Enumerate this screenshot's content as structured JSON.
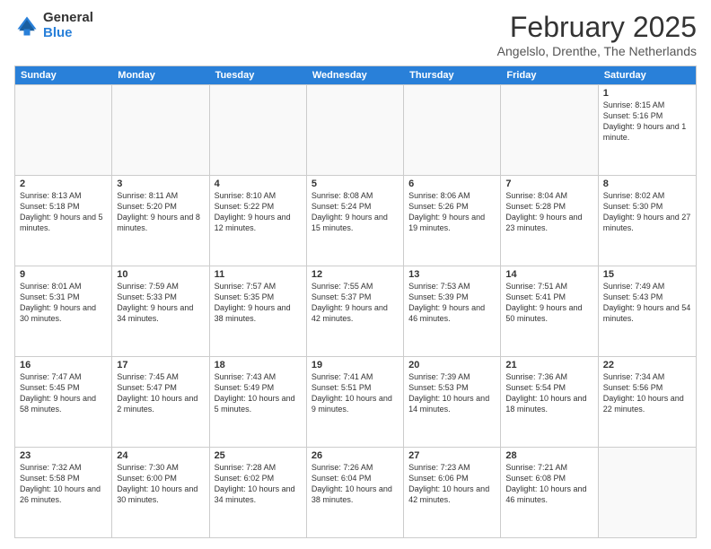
{
  "logo": {
    "general": "General",
    "blue": "Blue"
  },
  "header": {
    "month": "February 2025",
    "location": "Angelslo, Drenthe, The Netherlands"
  },
  "days": [
    "Sunday",
    "Monday",
    "Tuesday",
    "Wednesday",
    "Thursday",
    "Friday",
    "Saturday"
  ],
  "weeks": [
    [
      {
        "day": "",
        "text": ""
      },
      {
        "day": "",
        "text": ""
      },
      {
        "day": "",
        "text": ""
      },
      {
        "day": "",
        "text": ""
      },
      {
        "day": "",
        "text": ""
      },
      {
        "day": "",
        "text": ""
      },
      {
        "day": "1",
        "text": "Sunrise: 8:15 AM\nSunset: 5:16 PM\nDaylight: 9 hours and 1 minute."
      }
    ],
    [
      {
        "day": "2",
        "text": "Sunrise: 8:13 AM\nSunset: 5:18 PM\nDaylight: 9 hours and 5 minutes."
      },
      {
        "day": "3",
        "text": "Sunrise: 8:11 AM\nSunset: 5:20 PM\nDaylight: 9 hours and 8 minutes."
      },
      {
        "day": "4",
        "text": "Sunrise: 8:10 AM\nSunset: 5:22 PM\nDaylight: 9 hours and 12 minutes."
      },
      {
        "day": "5",
        "text": "Sunrise: 8:08 AM\nSunset: 5:24 PM\nDaylight: 9 hours and 15 minutes."
      },
      {
        "day": "6",
        "text": "Sunrise: 8:06 AM\nSunset: 5:26 PM\nDaylight: 9 hours and 19 minutes."
      },
      {
        "day": "7",
        "text": "Sunrise: 8:04 AM\nSunset: 5:28 PM\nDaylight: 9 hours and 23 minutes."
      },
      {
        "day": "8",
        "text": "Sunrise: 8:02 AM\nSunset: 5:30 PM\nDaylight: 9 hours and 27 minutes."
      }
    ],
    [
      {
        "day": "9",
        "text": "Sunrise: 8:01 AM\nSunset: 5:31 PM\nDaylight: 9 hours and 30 minutes."
      },
      {
        "day": "10",
        "text": "Sunrise: 7:59 AM\nSunset: 5:33 PM\nDaylight: 9 hours and 34 minutes."
      },
      {
        "day": "11",
        "text": "Sunrise: 7:57 AM\nSunset: 5:35 PM\nDaylight: 9 hours and 38 minutes."
      },
      {
        "day": "12",
        "text": "Sunrise: 7:55 AM\nSunset: 5:37 PM\nDaylight: 9 hours and 42 minutes."
      },
      {
        "day": "13",
        "text": "Sunrise: 7:53 AM\nSunset: 5:39 PM\nDaylight: 9 hours and 46 minutes."
      },
      {
        "day": "14",
        "text": "Sunrise: 7:51 AM\nSunset: 5:41 PM\nDaylight: 9 hours and 50 minutes."
      },
      {
        "day": "15",
        "text": "Sunrise: 7:49 AM\nSunset: 5:43 PM\nDaylight: 9 hours and 54 minutes."
      }
    ],
    [
      {
        "day": "16",
        "text": "Sunrise: 7:47 AM\nSunset: 5:45 PM\nDaylight: 9 hours and 58 minutes."
      },
      {
        "day": "17",
        "text": "Sunrise: 7:45 AM\nSunset: 5:47 PM\nDaylight: 10 hours and 2 minutes."
      },
      {
        "day": "18",
        "text": "Sunrise: 7:43 AM\nSunset: 5:49 PM\nDaylight: 10 hours and 5 minutes."
      },
      {
        "day": "19",
        "text": "Sunrise: 7:41 AM\nSunset: 5:51 PM\nDaylight: 10 hours and 9 minutes."
      },
      {
        "day": "20",
        "text": "Sunrise: 7:39 AM\nSunset: 5:53 PM\nDaylight: 10 hours and 14 minutes."
      },
      {
        "day": "21",
        "text": "Sunrise: 7:36 AM\nSunset: 5:54 PM\nDaylight: 10 hours and 18 minutes."
      },
      {
        "day": "22",
        "text": "Sunrise: 7:34 AM\nSunset: 5:56 PM\nDaylight: 10 hours and 22 minutes."
      }
    ],
    [
      {
        "day": "23",
        "text": "Sunrise: 7:32 AM\nSunset: 5:58 PM\nDaylight: 10 hours and 26 minutes."
      },
      {
        "day": "24",
        "text": "Sunrise: 7:30 AM\nSunset: 6:00 PM\nDaylight: 10 hours and 30 minutes."
      },
      {
        "day": "25",
        "text": "Sunrise: 7:28 AM\nSunset: 6:02 PM\nDaylight: 10 hours and 34 minutes."
      },
      {
        "day": "26",
        "text": "Sunrise: 7:26 AM\nSunset: 6:04 PM\nDaylight: 10 hours and 38 minutes."
      },
      {
        "day": "27",
        "text": "Sunrise: 7:23 AM\nSunset: 6:06 PM\nDaylight: 10 hours and 42 minutes."
      },
      {
        "day": "28",
        "text": "Sunrise: 7:21 AM\nSunset: 6:08 PM\nDaylight: 10 hours and 46 minutes."
      },
      {
        "day": "",
        "text": ""
      }
    ]
  ]
}
